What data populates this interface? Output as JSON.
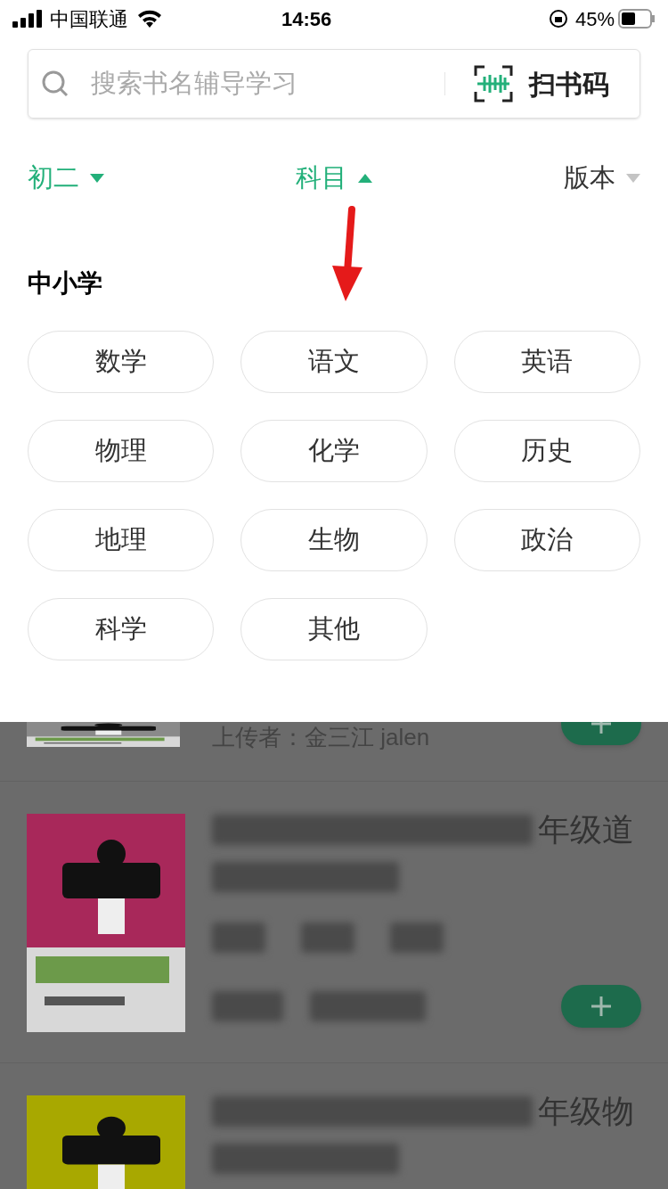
{
  "status_bar": {
    "carrier": "中国联通",
    "time": "14:56",
    "battery": "45%"
  },
  "search": {
    "placeholder": "搜索书名辅导学习",
    "scan_label": "扫书码"
  },
  "filters": [
    {
      "label": "初二",
      "active": true,
      "expanded": false
    },
    {
      "label": "科目",
      "active": true,
      "expanded": true
    },
    {
      "label": "版本",
      "active": false,
      "expanded": false
    }
  ],
  "section_title": "中小学",
  "subjects": [
    "数学",
    "语文",
    "英语",
    "物理",
    "化学",
    "历史",
    "地理",
    "生物",
    "政治",
    "科学",
    "其他"
  ],
  "books": [
    {
      "kind": "partial",
      "uploader": "上传者：金三江 jalen"
    },
    {
      "kind": "full",
      "title_tail": "年级道"
    },
    {
      "kind": "top",
      "title_tail": "年级物"
    }
  ]
}
